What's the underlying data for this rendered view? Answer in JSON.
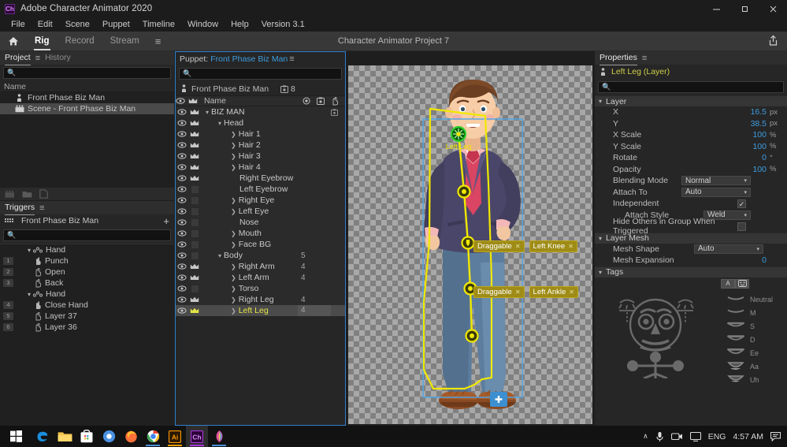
{
  "titlebar": {
    "app_title": "Adobe Character Animator 2020",
    "logo_text": "Ch",
    "minimize": "─",
    "maximize": "❐",
    "close": "✕"
  },
  "menubar": {
    "items": [
      "File",
      "Edit",
      "Scene",
      "Puppet",
      "Timeline",
      "Window",
      "Help",
      "Version 3.1"
    ]
  },
  "workspace_bar": {
    "home_icon": "home-icon",
    "tabs": [
      {
        "label": "Rig",
        "active": true
      },
      {
        "label": "Record",
        "active": false
      },
      {
        "label": "Stream",
        "active": false
      }
    ],
    "burger": "≡",
    "project_title": "Character Animator Project 7",
    "share_icon": "share-icon"
  },
  "project_panel": {
    "tabs": [
      {
        "label": "Project",
        "active": true
      },
      {
        "label": "History",
        "active": false
      }
    ],
    "burger": "≡",
    "search_placeholder": "",
    "column_header": "Name",
    "rows": [
      {
        "label": "Front Phase Biz Man",
        "icon": "puppet-icon",
        "selected": false
      },
      {
        "label": "Scene - Front Phase Biz Man",
        "icon": "scene-icon",
        "selected": true
      }
    ],
    "footer_icons": [
      "scene-icon",
      "folder-icon",
      "new-item-icon"
    ]
  },
  "triggers_panel": {
    "tab": "Triggers",
    "burger": "≡",
    "puppet_name": "Front Phase Biz Man",
    "grid_icon": "keyboard-grid-icon",
    "add_icon": "+",
    "search_placeholder": "",
    "rows": [
      {
        "type": "group",
        "label": "Hand",
        "num": "",
        "icon": "swap-set-icon",
        "expanded": true
      },
      {
        "type": "item",
        "label": "Punch",
        "num": "1",
        "icon": "hand-icon"
      },
      {
        "type": "item",
        "label": "Open",
        "num": "2",
        "icon": "hand-icon"
      },
      {
        "type": "item",
        "label": "Back",
        "num": "3",
        "icon": "hand-icon"
      },
      {
        "type": "group",
        "label": "Hand",
        "num": "",
        "icon": "swap-set-icon",
        "expanded": true
      },
      {
        "type": "item",
        "label": "Close Hand",
        "num": "4",
        "icon": "hand-icon"
      },
      {
        "type": "item",
        "label": "Layer 37",
        "num": "5",
        "icon": "hand-icon"
      },
      {
        "type": "item",
        "label": "Layer 36",
        "num": "6",
        "icon": "hand-icon"
      }
    ]
  },
  "puppet_panel": {
    "title_label": "Puppet:",
    "title_name": "Front Phase Biz Man",
    "burger": "≡",
    "puppet_icon": "puppet-icon",
    "puppet_name": "Front Phase Biz Man",
    "tag_icon": "tag-icon",
    "tag_count": "8",
    "search_placeholder": "",
    "columns": {
      "name": "Name",
      "eye_icon": "eye-icon",
      "crown_icon": "crown-icon",
      "visible_icon": "visibility-icon",
      "tag_icon": "tag-icon",
      "handle_icon": "handle-icon"
    },
    "layers": [
      {
        "name": "BIZ MAN",
        "indent": 0,
        "arrow": "down",
        "eye": true,
        "crown": true,
        "count": "",
        "tag": true,
        "selected": false
      },
      {
        "name": "Head",
        "indent": 1,
        "arrow": "down",
        "eye": true,
        "crown": true,
        "count": "",
        "tag": false,
        "selected": false
      },
      {
        "name": "Hair 1",
        "indent": 2,
        "arrow": "right",
        "eye": true,
        "crown": true,
        "count": "",
        "tag": false,
        "selected": false
      },
      {
        "name": "Hair 2",
        "indent": 2,
        "arrow": "right",
        "eye": true,
        "crown": true,
        "count": "",
        "tag": false,
        "selected": false
      },
      {
        "name": "Hair 3",
        "indent": 2,
        "arrow": "right",
        "eye": true,
        "crown": true,
        "count": "",
        "tag": false,
        "selected": false
      },
      {
        "name": "Hair 4",
        "indent": 2,
        "arrow": "right",
        "eye": true,
        "crown": true,
        "count": "",
        "tag": false,
        "selected": false
      },
      {
        "name": "Right Eyebrow",
        "indent": 2,
        "arrow": "none",
        "eye": true,
        "crown": true,
        "count": "",
        "tag": false,
        "selected": false
      },
      {
        "name": "Left Eyebrow",
        "indent": 2,
        "arrow": "none",
        "eye": true,
        "crown": false,
        "count": "",
        "tag": false,
        "selected": false
      },
      {
        "name": "Right Eye",
        "indent": 2,
        "arrow": "right",
        "eye": true,
        "crown": false,
        "count": "",
        "tag": false,
        "selected": false
      },
      {
        "name": "Left Eye",
        "indent": 2,
        "arrow": "right",
        "eye": true,
        "crown": false,
        "count": "",
        "tag": false,
        "selected": false
      },
      {
        "name": "Nose",
        "indent": 2,
        "arrow": "none",
        "eye": true,
        "crown": false,
        "count": "",
        "tag": false,
        "selected": false
      },
      {
        "name": "Mouth",
        "indent": 2,
        "arrow": "right",
        "eye": true,
        "crown": false,
        "count": "",
        "tag": false,
        "selected": false
      },
      {
        "name": "Face BG",
        "indent": 2,
        "arrow": "right",
        "eye": true,
        "crown": false,
        "count": "",
        "tag": false,
        "selected": false
      },
      {
        "name": "Body",
        "indent": 1,
        "arrow": "down",
        "eye": true,
        "crown": false,
        "count": "5",
        "tag": false,
        "selected": false
      },
      {
        "name": "Right Arm",
        "indent": 2,
        "arrow": "right",
        "eye": true,
        "crown": true,
        "count": "4",
        "tag": false,
        "selected": false
      },
      {
        "name": "Left Arm",
        "indent": 2,
        "arrow": "right",
        "eye": true,
        "crown": true,
        "count": "4",
        "tag": false,
        "selected": false
      },
      {
        "name": "Torso",
        "indent": 2,
        "arrow": "right",
        "eye": true,
        "crown": false,
        "count": "",
        "tag": false,
        "selected": false
      },
      {
        "name": "Right Leg",
        "indent": 2,
        "arrow": "right",
        "eye": true,
        "crown": true,
        "count": "4",
        "tag": false,
        "selected": false
      },
      {
        "name": "Left Leg",
        "indent": 2,
        "arrow": "right",
        "eye": true,
        "crown": true,
        "count": "4",
        "tag": false,
        "selected": true
      }
    ]
  },
  "canvas": {
    "handle_label": "Left Leg",
    "tags": [
      {
        "row": "knee",
        "labels": [
          "Draggable",
          "Left Knee"
        ]
      },
      {
        "row": "ankle",
        "labels": [
          "Draggable",
          "Left Ankle"
        ]
      }
    ],
    "tag_close": "✕",
    "add_handle_icon": "+",
    "colors": {
      "handle_yellow": "#f0e800",
      "origin_green": "#16a016",
      "selection_blue": "#4ea5e8",
      "tag_bg": "#9e8c16"
    }
  },
  "properties_panel": {
    "tab": "Properties",
    "burger": "≡",
    "selected_item": "Left Leg (Layer)",
    "item_icon": "puppet-icon",
    "search_placeholder": "",
    "sections": [
      {
        "title": "Layer",
        "rows": [
          {
            "key": "X",
            "value": "16.5",
            "unit": "px",
            "type": "number"
          },
          {
            "key": "Y",
            "value": "38.5",
            "unit": "px",
            "type": "number"
          },
          {
            "key": "X Scale",
            "value": "100",
            "unit": "%",
            "type": "number"
          },
          {
            "key": "Y Scale",
            "value": "100",
            "unit": "%",
            "type": "number"
          },
          {
            "key": "Rotate",
            "value": "0",
            "unit": "°",
            "type": "number"
          },
          {
            "key": "Opacity",
            "value": "100",
            "unit": "%",
            "type": "number"
          },
          {
            "key": "Blending Mode",
            "value": "Normal",
            "unit": "",
            "type": "select"
          },
          {
            "key": "Attach To",
            "value": "Auto",
            "unit": "",
            "type": "select"
          },
          {
            "key": "Independent",
            "value": "checked",
            "unit": "",
            "type": "checkbox"
          },
          {
            "key": "Attach Style",
            "value": "Weld",
            "unit": "",
            "type": "select-sm",
            "indent": true
          },
          {
            "key": "Hide Others in Group When Triggered",
            "value": "unchecked",
            "unit": "",
            "type": "checkbox-wide"
          }
        ]
      },
      {
        "title": "Layer Mesh",
        "rows": [
          {
            "key": "Mesh Shape",
            "value": "Auto",
            "unit": "",
            "type": "select"
          },
          {
            "key": "Mesh Expansion",
            "value": "0",
            "unit": "",
            "type": "number"
          }
        ]
      },
      {
        "title": "Tags",
        "rows": []
      }
    ],
    "tag_buttons": [
      "A",
      "face-icon"
    ],
    "visemes": [
      "Neutral",
      "M",
      "S",
      "D",
      "Ee",
      "Aa",
      "Uh"
    ]
  },
  "taskbar": {
    "start_icon": "windows-icon",
    "apps": [
      {
        "name": "edge-icon",
        "active": false
      },
      {
        "name": "file-explorer-icon",
        "active": false
      },
      {
        "name": "store-icon",
        "active": false
      },
      {
        "name": "browser-icon",
        "active": false
      },
      {
        "name": "firefox-icon",
        "active": false
      },
      {
        "name": "chrome-icon",
        "active": false
      },
      {
        "name": "illustrator-icon",
        "active": false
      },
      {
        "name": "character-animator-icon",
        "active": true
      },
      {
        "name": "photos-icon",
        "active": false
      }
    ],
    "tray": {
      "chevron": "∧",
      "mic_icon": "microphone-icon",
      "camera_icon": "camera-icon",
      "display_icon": "display-icon",
      "language": "ENG",
      "time": "4:57 AM",
      "notify_icon": "notification-icon"
    }
  }
}
